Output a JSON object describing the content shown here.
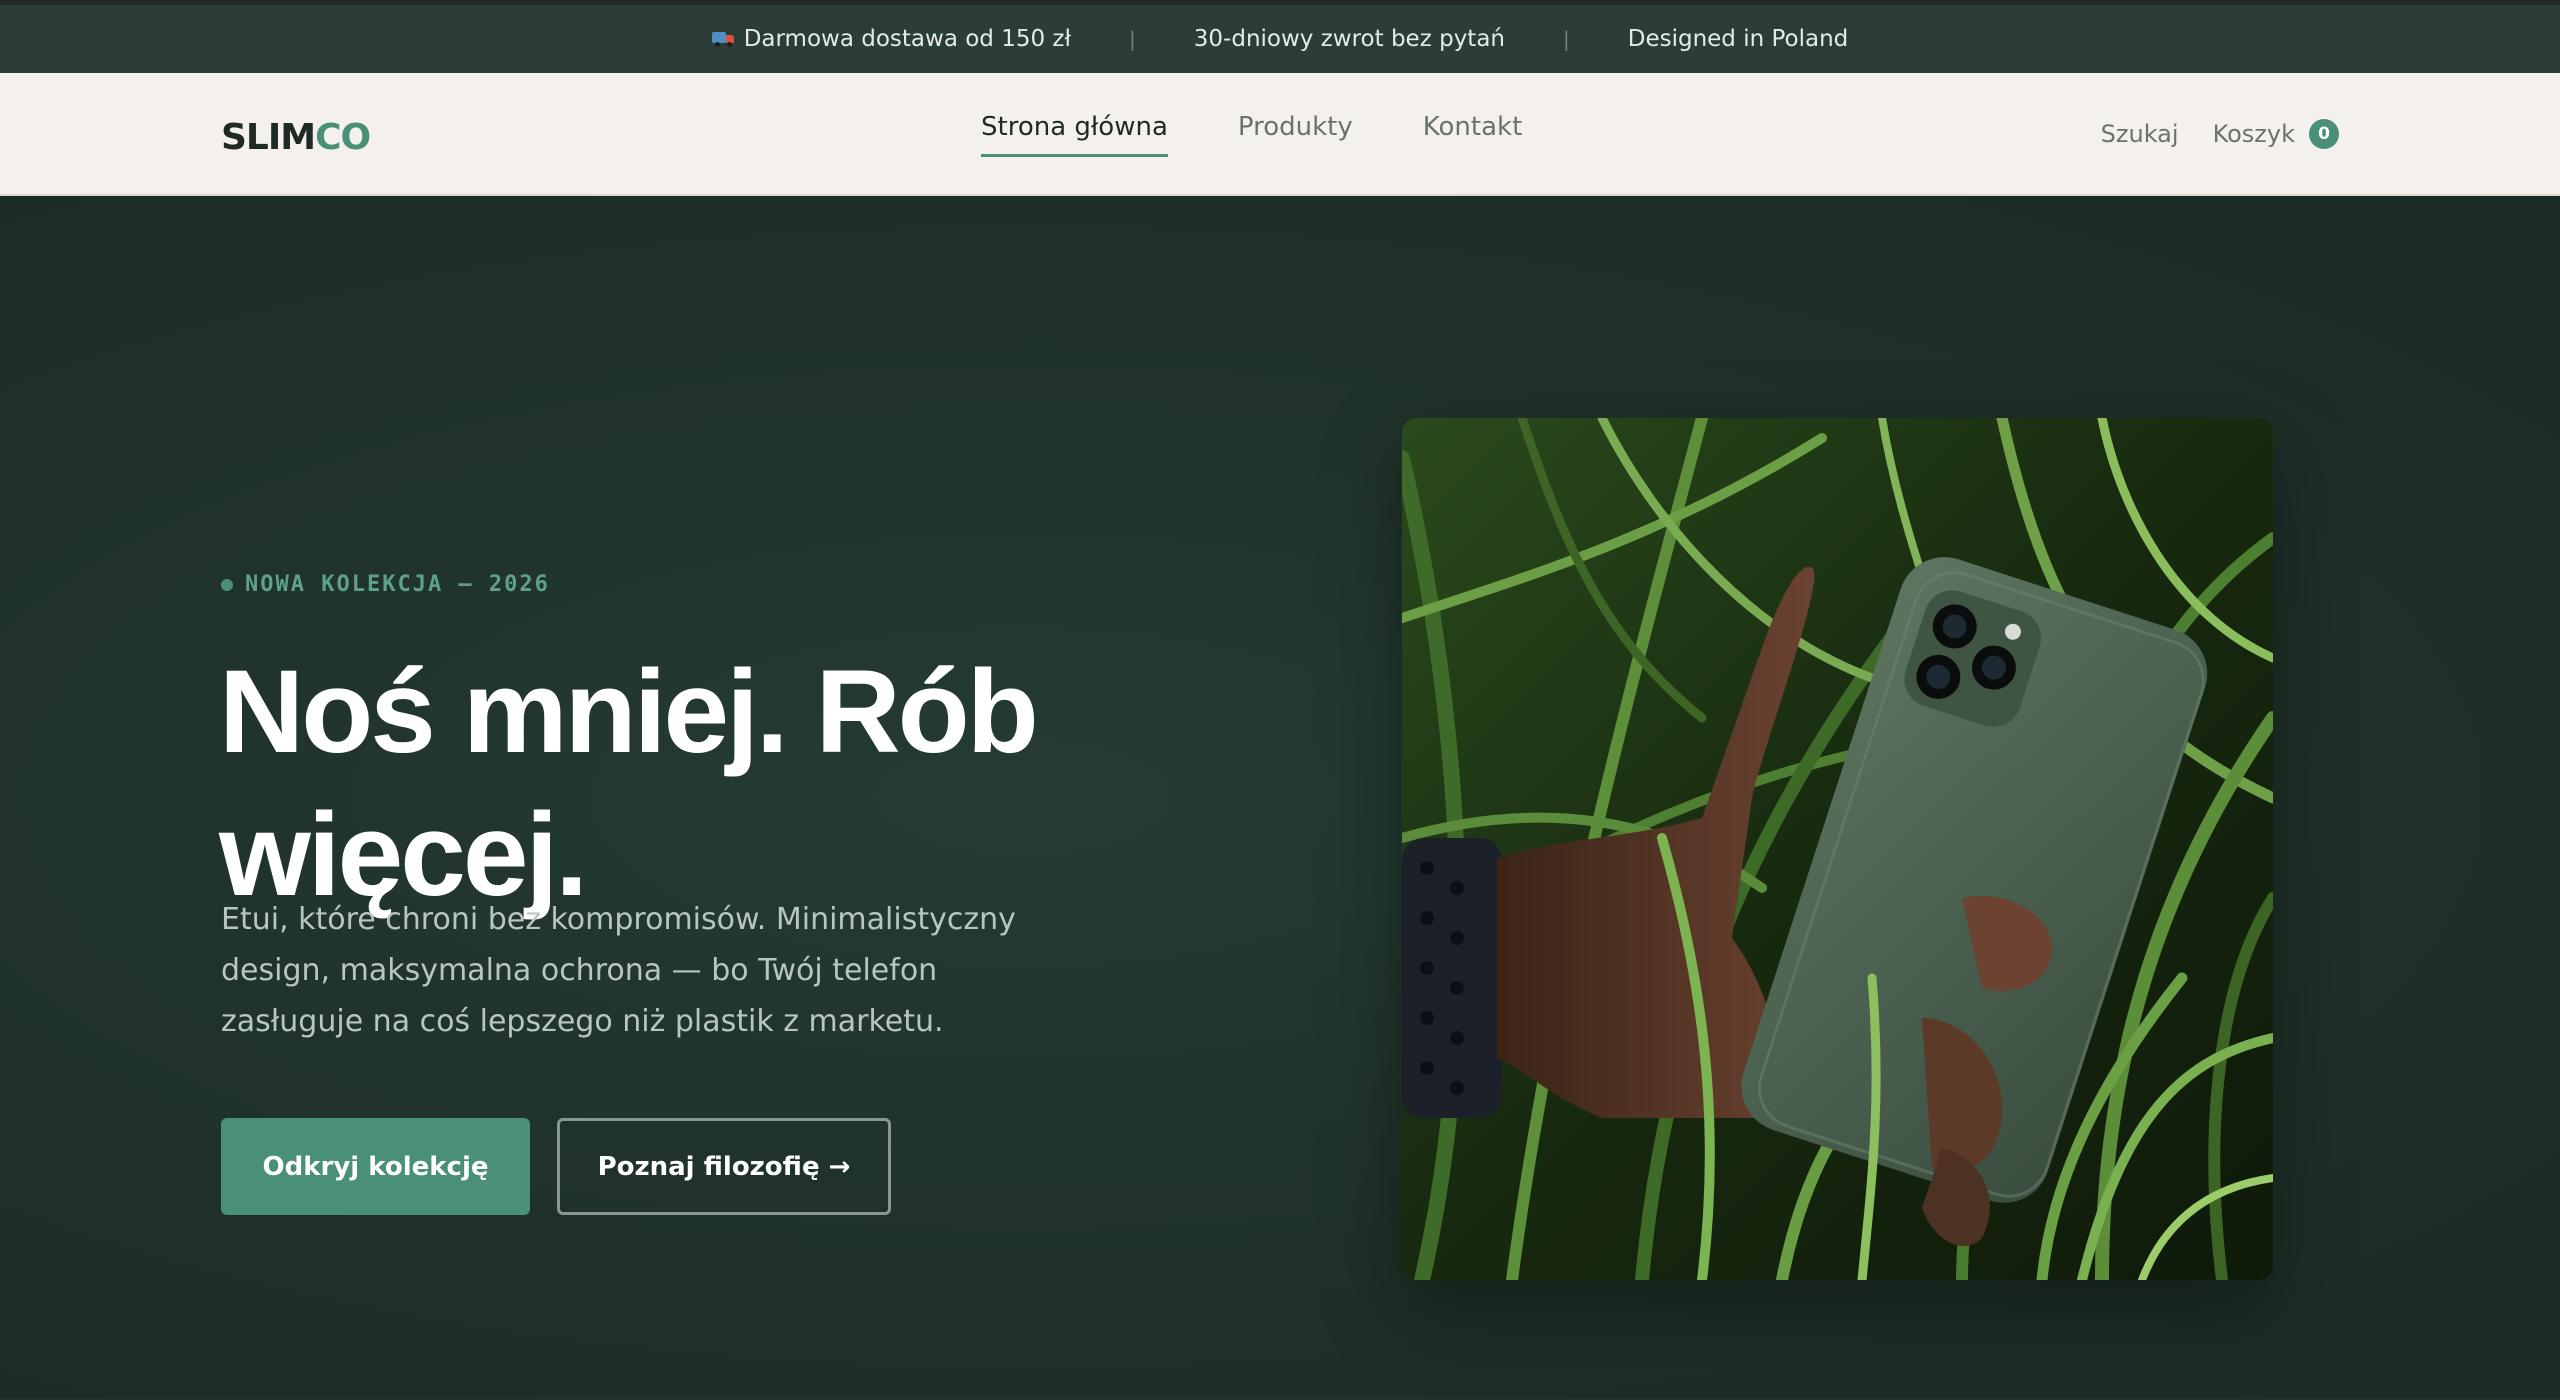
{
  "announcement": {
    "items": [
      "Darmowa dostawa od 150 zł",
      "30-dniowy zwrot bez pytań",
      "Designed in Poland"
    ],
    "separator": "|"
  },
  "nav": {
    "logo_part1": "SLIM",
    "logo_part2": "CO",
    "links": [
      {
        "label": "Strona główna",
        "active": true
      },
      {
        "label": "Produkty",
        "active": false
      },
      {
        "label": "Kontakt",
        "active": false
      }
    ],
    "search_label": "Szukaj",
    "cart_label": "Koszyk",
    "cart_count": "0"
  },
  "hero": {
    "eyebrow": "NOWA KOLEKCJA — 2026",
    "headline_line1": "Noś mniej. Rób",
    "headline_line2": "więcej.",
    "lead": "Etui, które chroni bez kompromisów. Minimalistyczny design, maksymalna ochrona — bo Twój telefon zasługuje na coś lepszego niż plastik z marketu.",
    "primary_cta": "Odkryj kolekcję",
    "secondary_cta": "Poznaj filozofię →"
  },
  "colors": {
    "accent": "#4a8f78",
    "hero_bg": "#1f342c",
    "nav_bg": "#f4f1ec",
    "announce_bg": "#2c3d37"
  },
  "icons": [
    "truck-icon",
    "cart-count-badge"
  ]
}
